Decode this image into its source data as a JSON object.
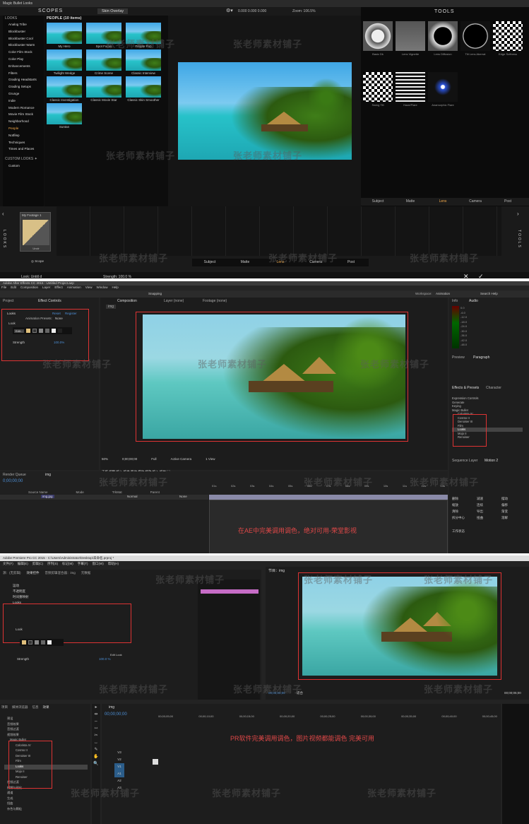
{
  "mbl": {
    "app_title": "Magic Bullet Looks",
    "scopes_label": "SCOPES",
    "skin_overlay": "Skin Overlay",
    "percent_readout": "0.000   0.000   0.000",
    "zoom": "Zoom: 106.5%",
    "tools_label": "TOOLS",
    "looks_header": "LOOKS",
    "looks": [
      "Analog Tribe",
      "Blockbuster",
      "Blockbuster Cool",
      "Blockbuster Warm",
      "Color Film Stock",
      "Color Play",
      "Enhancements",
      "Filters",
      "Grading Headstarts",
      "Grading Setups",
      "Grunge",
      "Indie",
      "Modern Romance",
      "Movie Film Stock",
      "Neighborhood",
      "People",
      "Notfilep",
      "Techniques",
      "Times and Places"
    ],
    "looks_selected": "People",
    "custom_looks": "CUSTOM LOOKS  ✦",
    "custom_item": "Custom",
    "people_header": "PEOPLE (10 items)",
    "presets": [
      "My Hero",
      "Spot Focus",
      "People Pop",
      "Twilight Wedge",
      "Crime Scene",
      "Classic Interview",
      "Classic Investigation",
      "Classic Movie Star",
      "Classic Skin Smoother",
      "Suntan"
    ],
    "tool_labels": [
      "Basic Dk",
      "Lens Vignette",
      "Lens Diffusion",
      "Tilt Lens Aberrat",
      "Edge Softness",
      "Swing Tilt",
      "Haze/Flare",
      "Anamorphic Flare"
    ],
    "tool_tabs": [
      "Subject",
      "Matte",
      "Lens",
      "Camera",
      "Post"
    ],
    "tool_tab_selected": "Lens",
    "footage_label": "My Footage 1",
    "footage_sub": "Unclr",
    "scope_item": "Scope",
    "looks_vertical": "LOOKS",
    "tools_vertical": "TOOLS",
    "bottom_tabs": [
      "Subject",
      "Matte",
      "Lens",
      "Camera",
      "Post"
    ],
    "bottom_tab_selected": "Lens",
    "look_readout": "Look: Untitl d",
    "strength_readout": "Strength: 100.0 %"
  },
  "ae": {
    "title": "Adobe After Effects CC 2015 - Untitled Project.aep",
    "menu": [
      "File",
      "Edit",
      "Composition",
      "Layer",
      "Effect",
      "Animation",
      "View",
      "Window",
      "Help"
    ],
    "toolbar_snapping": "Snapping",
    "workspace": [
      "Workspace:",
      "Animation"
    ],
    "search_help": "Search Help",
    "project_tab": "Project",
    "effect_controls_tab": "Effect Controls",
    "fx_name": "Looks",
    "fx_links": [
      "Reset",
      "Register"
    ],
    "animation_presets": "Animation Presets:",
    "animation_presets_value": "None",
    "look_label": "Look",
    "edit_label": "Edit...",
    "strength_label": "Strength",
    "strength_value": "100.0%",
    "composition_tab": "Composition",
    "comp_name": "img",
    "layer_tab": "Layer  (none)",
    "footage_tab": "Footage  (none)",
    "viewer_footer": [
      "50%",
      "0;00;00;00",
      "Full",
      "Active Camera",
      "1 View"
    ],
    "preview_panel": "Preview",
    "paragraph_panel": "Paragraph",
    "info_tab": "Info",
    "audio_tab": "Audio",
    "audio_levels": [
      "0.0",
      "-6.0",
      "-12.0",
      "-18.0",
      "-24.0",
      "-30.0",
      "-36.0",
      "-42.0",
      "-48.0"
    ],
    "effects_presets_tab": "Effects & Presets",
    "character_tab": "Character",
    "effects_list": [
      "Expression Controls",
      "Generate",
      "Keying",
      "Magic Bullet"
    ],
    "effects_sub": [
      "Colorista IV",
      "Cosmo II",
      "Denoiser III",
      "Film",
      "Looks",
      "Mojo II",
      "Renoiser"
    ],
    "effects_selected": "Looks",
    "sequence_tab": "Sequence Layer",
    "motion_tab": "Motion 2",
    "timeline_tab": "img",
    "render_queue_tab": "Render Queue",
    "timecode": "0;00;00;00",
    "timeline_headers": [
      "Source Name",
      "Mode",
      "TrkMat",
      "Parent"
    ],
    "layer_name": "img.jpg",
    "layer_mode": "Normal",
    "layer_parent": "None",
    "ruler": [
      "01s",
      "02s",
      "03s",
      "04s",
      "05s",
      "06s",
      "07s",
      "08s",
      "09s",
      "10s",
      "11s",
      "12s",
      "13s"
    ],
    "caption": "在AE中完美调用调色，绝对可用-荣堂影视",
    "side_buttons": [
      "删除",
      "减速",
      "摆动",
      "缩放",
      "连续",
      "偏移",
      "清除",
      "导出",
      "渐变",
      "拆分中心",
      "扭曲",
      "溶解"
    ],
    "side_status": "工作状态"
  },
  "pr": {
    "title": "Adobe Premiere Pro CC 2015 - C:\\Users\\Administrator\\Desktop\\未命名.prproj *",
    "menu": [
      "文件(F)",
      "编辑(E)",
      "剪辑(C)",
      "序列(S)",
      "标记(M)",
      "字幕(T)",
      "窗口(W)",
      "帮助(H)"
    ],
    "source_tabs": [
      "源：(无剪辑)",
      "效果控件",
      "音频剪辑混合器：img",
      "元数据"
    ],
    "fx_rows": [
      "运动",
      "不透明度",
      "时间重映射",
      "Looks"
    ],
    "look_label": "Look",
    "strength_label": "Strength",
    "strength_value": "100.0 %",
    "edit_label": "Edit Look",
    "program_tab": "节目：img",
    "timecode_left": "00;00;00;00",
    "fit": "适合",
    "timecode_right": "00;00;05;00",
    "project_tabs": [
      "项目",
      "媒体浏览器",
      "信息",
      "效果"
    ],
    "effects_tree": [
      "预设",
      "音频效果",
      "音频过渡",
      "视频效果",
      "Magic Bullet",
      "Colorista IV",
      "Cosmo II",
      "Denoiser III",
      "Film",
      "Looks",
      "Mojo II",
      "Renoiser",
      "视频过渡",
      "模糊与锐化",
      "通道",
      "生成",
      "扭曲",
      "杂色与颗粒"
    ],
    "seq_tab": "img",
    "seq_timecode": "00;00;00;00",
    "tracks": [
      "V3",
      "V2",
      "V1",
      "A1",
      "A2",
      "A3"
    ],
    "ruler": [
      "00;00;05;00",
      "00;00;10;00",
      "00;00;15;00",
      "00;00;20;00",
      "00;00;25;00",
      "00;00;30;00",
      "00;00;35;00",
      "00;00;40;00",
      "00;00;45;00"
    ],
    "caption": "PR软件完美调用调色，图片视频都能调色 完美可用"
  },
  "watermark": "张老师素材铺子",
  "colors": {
    "accent_orange": "#f2a94a",
    "red_box": "#d33",
    "caption_red": "#e04848",
    "ae_blue": "#2e8fd6"
  }
}
